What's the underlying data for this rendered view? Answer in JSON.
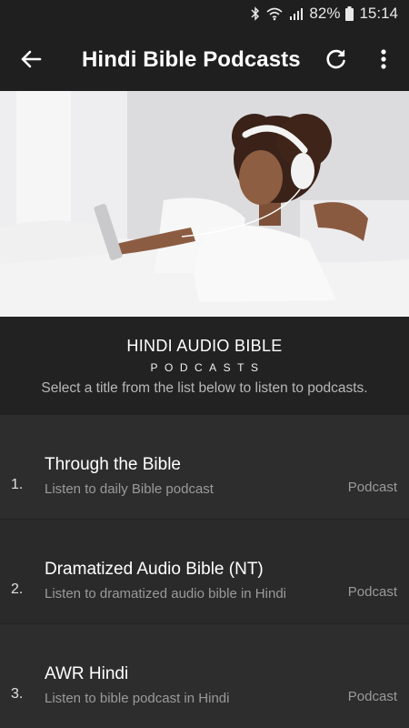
{
  "status_bar": {
    "battery_percent": "82%",
    "time": "15:14",
    "icons": [
      "bluetooth-icon",
      "wifi-icon",
      "signal-icon",
      "battery-icon"
    ]
  },
  "app_bar": {
    "title": "Hindi Bible Podcasts",
    "icons": [
      "back-arrow-icon",
      "refresh-icon",
      "more-vert-icon"
    ]
  },
  "hero": {
    "description_icon": "woman-listening-headphones-image"
  },
  "header": {
    "title": "HINDI AUDIO BIBLE",
    "subtitle": "PODCASTS",
    "instruction": "Select a title from the list below to listen to podcasts."
  },
  "list": [
    {
      "number": "1.",
      "title": "Through the Bible",
      "subtitle": "Listen to daily Bible podcast",
      "tag": "Podcast"
    },
    {
      "number": "2.",
      "title": "Dramatized Audio Bible (NT)",
      "subtitle": "Listen to dramatized audio bible in Hindi",
      "tag": "Podcast"
    },
    {
      "number": "3.",
      "title": "AWR Hindi",
      "subtitle": "Listen to bible podcast in Hindi",
      "tag": "Podcast"
    }
  ],
  "colors": {
    "app_bar": "#1f1f1f",
    "background": "#2b2b2b",
    "header_block": "#222222",
    "text_primary": "#ffffff",
    "text_secondary": "#9a9a9a"
  }
}
